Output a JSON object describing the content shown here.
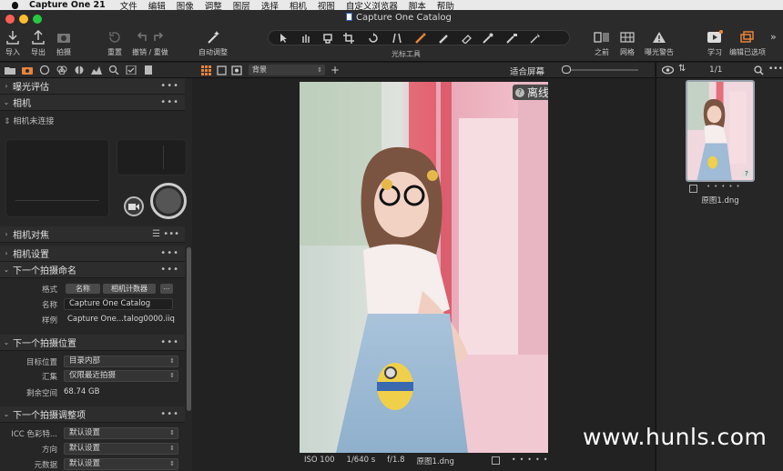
{
  "menubar": {
    "app_name": "Capture One 21",
    "items": [
      "文件",
      "编辑",
      "图像",
      "调整",
      "图层",
      "选择",
      "相机",
      "视图",
      "自定义浏览器",
      "脚本",
      "帮助"
    ]
  },
  "window": {
    "title": "Capture One Catalog"
  },
  "toolbar": {
    "import_label": "导入",
    "export_label": "导出",
    "capture_label": "拍摄",
    "reset_label": "重置",
    "undo_redo_label": "撤销 / 重做",
    "auto_adjust_label": "自动调整",
    "cursor_tools_label": "光标工具",
    "before_label": "之前",
    "grid_label": "网格",
    "exposure_warning_label": "曝光警告",
    "learn_label": "学习",
    "edit_selected_label": "编辑已选项",
    "more_label": "»"
  },
  "viewer_bar": {
    "background_select": "背景",
    "fit_label": "适合屏幕"
  },
  "left_panel": {
    "sections": {
      "exposure_eval": "曝光评估",
      "camera": "相机",
      "camera_focus": "相机对焦",
      "camera_settings": "相机设置",
      "next_capture_naming": "下一个拍摄命名",
      "next_capture_location": "下一个拍摄位置",
      "next_capture_adjust": "下一个拍摄调整项"
    },
    "camera_status": "相机未连接",
    "naming": {
      "format_label": "格式",
      "format_tokens": [
        "名称",
        "相机计数器"
      ],
      "name_label": "名称",
      "name_value": "Capture One Catalog",
      "sample_label": "样例",
      "sample_value": "Capture One...talog0000.iiq"
    },
    "location": {
      "destination_label": "目标位置",
      "destination_value": "目录内部",
      "collection_label": "汇集",
      "collection_value": "仅限最近拍摄",
      "free_space_label": "剩余空间",
      "free_space_value": "68.74 GB"
    },
    "adjust": {
      "icc_label": "ICC 色彩特...",
      "icc_value": "默认设置",
      "orientation_label": "方向",
      "orientation_value": "默认设置",
      "metadata_label": "元数据",
      "metadata_value": "默认设置"
    }
  },
  "viewer": {
    "offline_badge": "离线",
    "meta": {
      "iso": "ISO 100",
      "shutter": "1/640 s",
      "aperture": "f/1.8",
      "filename": "原图1.dng"
    }
  },
  "browser": {
    "counter": "1/1",
    "thumbnail_name": "原图1.dng"
  },
  "watermark": "www.hunls.com",
  "colors": {
    "accent": "#e8833a",
    "close": "#fe5f57",
    "minimize": "#febc2e",
    "zoom": "#28c840"
  }
}
